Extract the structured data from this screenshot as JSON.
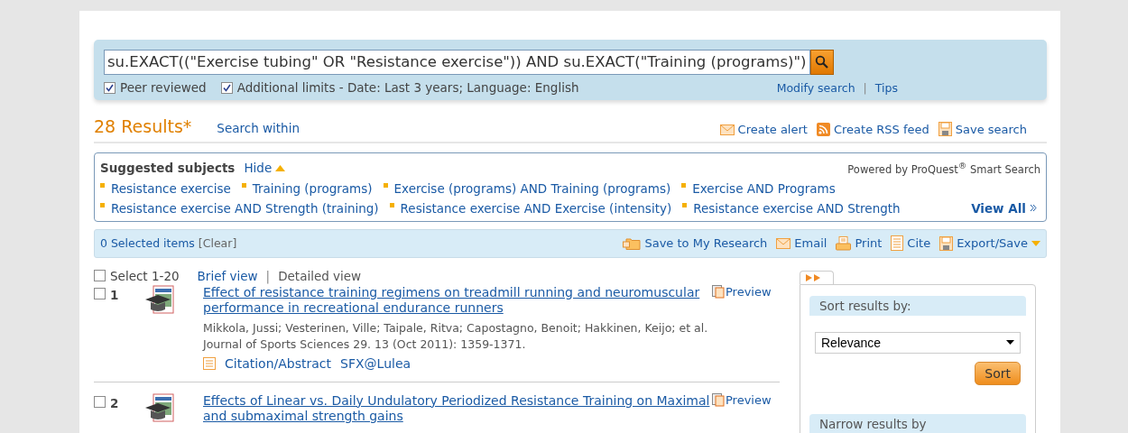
{
  "search": {
    "query": "su.EXACT((\"Exercise tubing\" OR \"Resistance exercise\")) AND su.EXACT(\"Training (programs)\")",
    "filters": [
      {
        "label": "Peer reviewed",
        "checked": true
      },
      {
        "label": "Additional limits - Date: Last 3 years; Language: English",
        "checked": true
      }
    ],
    "links": [
      "Modify search",
      "Tips"
    ],
    "separator": "|"
  },
  "results_header": {
    "count": "28 Results*",
    "search_within": "Search within",
    "actions": [
      {
        "kind": "alert",
        "label": "Create alert"
      },
      {
        "kind": "rss",
        "label": "Create RSS feed"
      },
      {
        "kind": "save",
        "label": "Save search"
      }
    ]
  },
  "suggested": {
    "title": "Suggested subjects",
    "hide": "Hide",
    "powered": "Powered by ProQuest$^{®}$ Smart Search",
    "view_all": "View All",
    "subjects": [
      "Resistance exercise",
      "Training (programs)",
      "Exercise (programs) AND Training (programs)",
      "Exercise AND Programs",
      "Resistance exercise AND Strength (training)",
      "Resistance exercise AND Exercise (intensity)",
      "Resistance exercise AND Strength"
    ]
  },
  "selection_bar": {
    "count": "0 Selected items",
    "clear": "[Clear]",
    "actions": [
      {
        "kind": "research",
        "label": "Save to My Research"
      },
      {
        "kind": "email",
        "label": "Email"
      },
      {
        "kind": "print",
        "label": "Print"
      },
      {
        "kind": "cite",
        "label": "Cite"
      },
      {
        "kind": "export",
        "label": "Export/Save"
      }
    ]
  },
  "list": {
    "select_all": {
      "label": "Select 1-20",
      "checked": false
    },
    "separator": "|",
    "views": [
      {
        "label": "Brief view",
        "selected": false
      },
      {
        "label": "Detailed view",
        "selected": true
      }
    ],
    "results": [
      {
        "number": "1",
        "checked": false,
        "title": "Effect of resistance training regimens on treadmill running and neuromuscular performance in recreational endurance runners",
        "preview": "Preview",
        "authors": "Mikkola, Jussi; Vesterinen, Ville; Taipale, Ritva; Capostagno, Benoit; Hakkinen, Keijo; et al. Journal of Sports Sciences 29. 13  (Oct 2011): 1359-1371.",
        "links": [
          "Citation/Abstract",
          "SFX@Lulea"
        ]
      },
      {
        "number": "2",
        "checked": false,
        "title": "Effects of Linear vs. Daily Undulatory Periodized Resistance Training on Maximal and submaximal strength gains",
        "preview": "Preview"
      }
    ]
  },
  "sidebar": {
    "sort_title": "Sort results by:",
    "sort_value": "Relevance",
    "sort_button": "Sort",
    "narrow_title": "Narrow results by"
  }
}
